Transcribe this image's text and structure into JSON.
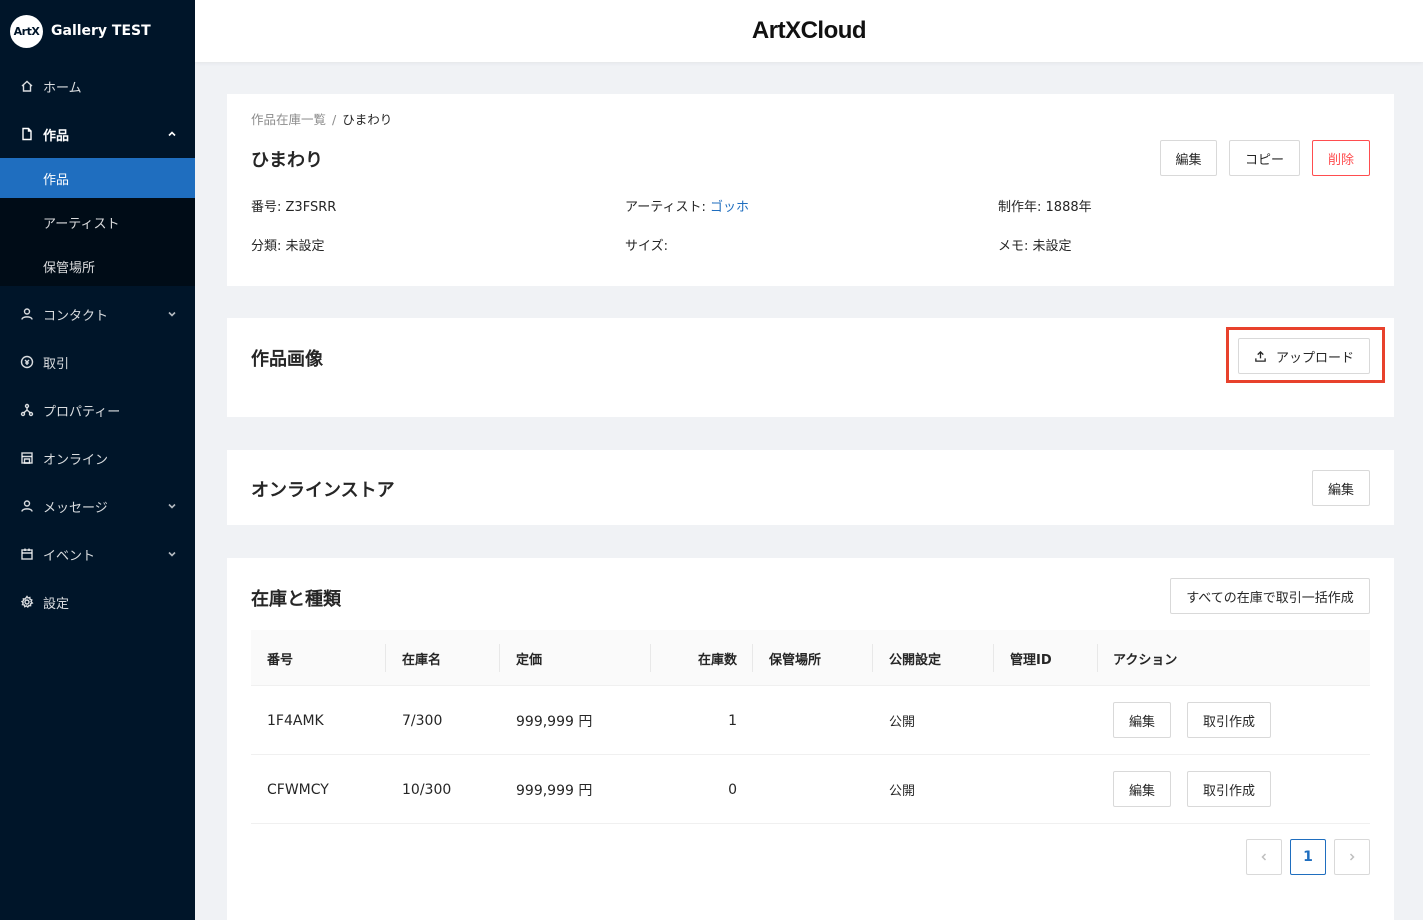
{
  "brand": {
    "logo_text": "ArtX",
    "name": "Gallery TEST"
  },
  "header": {
    "logo": "ArtXCloud"
  },
  "sidebar": {
    "items": [
      {
        "label": "ホーム",
        "icon": "home-icon"
      },
      {
        "label": "作品",
        "icon": "file-icon"
      },
      {
        "label": "コンタクト",
        "icon": "user-icon"
      },
      {
        "label": "取引",
        "icon": "transaction-icon"
      },
      {
        "label": "プロパティー",
        "icon": "nodes-icon"
      },
      {
        "label": "オンライン",
        "icon": "shop-icon"
      },
      {
        "label": "メッセージ",
        "icon": "user-icon"
      },
      {
        "label": "イベント",
        "icon": "calendar-icon"
      },
      {
        "label": "設定",
        "icon": "gear-icon"
      }
    ],
    "submenu": [
      {
        "label": "作品",
        "active": true
      },
      {
        "label": "アーティスト",
        "active": false
      },
      {
        "label": "保管場所",
        "active": false
      }
    ]
  },
  "detail": {
    "breadcrumb_parent": "作品在庫一覧",
    "breadcrumb_sep": "/",
    "breadcrumb_current": "ひまわり",
    "title": "ひまわり",
    "buttons": {
      "edit": "編集",
      "copy": "コピー",
      "delete": "削除"
    },
    "fields": {
      "number_label": "番号:",
      "number_value": "Z3FSRR",
      "artist_label": "アーティスト:",
      "artist_value": "ゴッホ",
      "year_label": "制作年:",
      "year_value": "1888年",
      "category_label": "分類:",
      "category_value": "未設定",
      "size_label": "サイズ:",
      "size_value": "",
      "memo_label": "メモ:",
      "memo_value": "未設定"
    }
  },
  "images": {
    "title": "作品画像",
    "upload_label": "アップロード"
  },
  "store": {
    "title": "オンラインストア",
    "edit_label": "編集"
  },
  "inventory": {
    "title": "在庫と種類",
    "bulk_button": "すべての在庫で取引一括作成",
    "columns": [
      "番号",
      "在庫名",
      "定価",
      "在庫数",
      "保管場所",
      "公開設定",
      "管理ID",
      "アクション"
    ],
    "rows": [
      {
        "number": "1F4AMK",
        "name": "7/300",
        "price": "999,999 円",
        "count": "1",
        "location": "",
        "visibility": "公開",
        "manage_id": "",
        "edit": "編集",
        "deal": "取引作成"
      },
      {
        "number": "CFWMCY",
        "name": "10/300",
        "price": "999,999 円",
        "count": "0",
        "location": "",
        "visibility": "公開",
        "manage_id": "",
        "edit": "編集",
        "deal": "取引作成"
      }
    ],
    "pagination": {
      "current": "1"
    }
  },
  "colors": {
    "sidebar_bg": "#001529",
    "accent": "#1f6ebf",
    "danger": "#ff4d4f",
    "highlight": "#e8412c"
  }
}
